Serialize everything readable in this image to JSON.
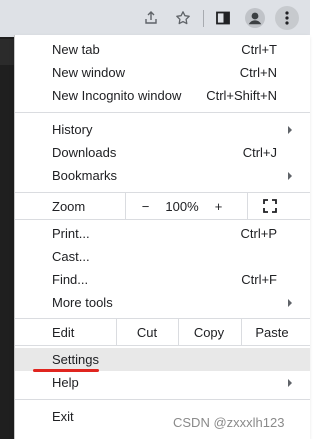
{
  "toolbar": {
    "icons": [
      "share-icon",
      "bookmark-star-icon",
      "side-panel-icon",
      "profile-icon",
      "more-vertical-icon"
    ]
  },
  "menu": {
    "new_tab": {
      "label": "New tab",
      "shortcut": "Ctrl+T"
    },
    "new_window": {
      "label": "New window",
      "shortcut": "Ctrl+N"
    },
    "new_incognito": {
      "label": "New Incognito window",
      "shortcut": "Ctrl+Shift+N"
    },
    "history": {
      "label": "History"
    },
    "downloads": {
      "label": "Downloads",
      "shortcut": "Ctrl+J"
    },
    "bookmarks": {
      "label": "Bookmarks"
    },
    "zoom": {
      "label": "Zoom",
      "minus": "−",
      "level": "100%",
      "plus": "+"
    },
    "print": {
      "label": "Print...",
      "shortcut": "Ctrl+P"
    },
    "cast": {
      "label": "Cast..."
    },
    "find": {
      "label": "Find...",
      "shortcut": "Ctrl+F"
    },
    "more_tools": {
      "label": "More tools"
    },
    "edit": {
      "label": "Edit",
      "cut": "Cut",
      "copy": "Copy",
      "paste": "Paste"
    },
    "settings": {
      "label": "Settings"
    },
    "help": {
      "label": "Help"
    },
    "exit": {
      "label": "Exit"
    }
  },
  "colors": {
    "annotation_red": "#e0251f",
    "highlight": "#e8e8e8",
    "toolbar_bg": "#dee1e6"
  },
  "watermark": "CSDN @zxxxlh123"
}
